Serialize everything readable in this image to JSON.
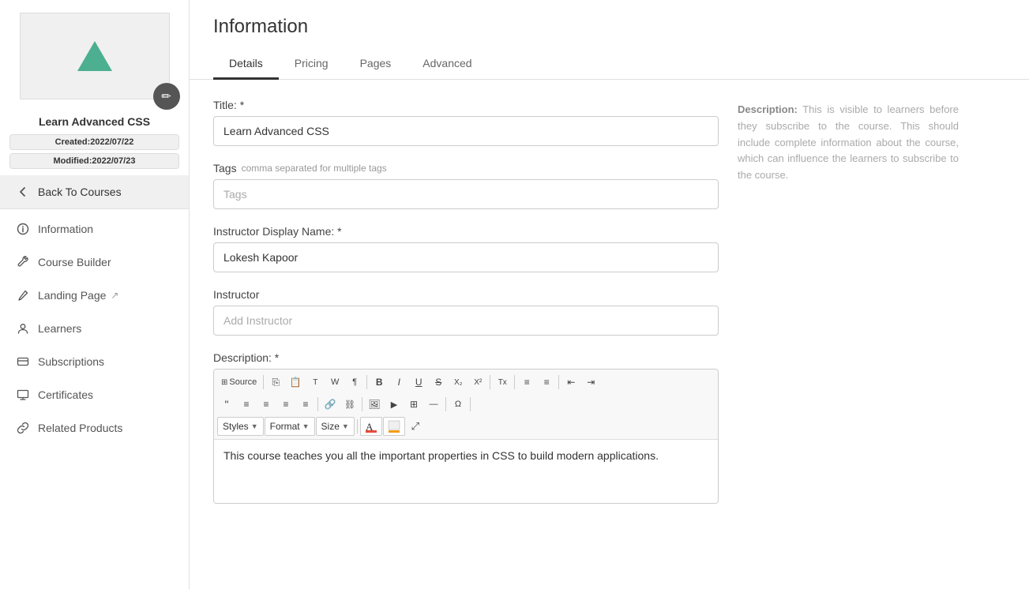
{
  "sidebar": {
    "course_title": "Learn Advanced CSS",
    "created_label": "Created:",
    "created_date": "2022/07/22",
    "modified_label": "Modified:",
    "modified_date": "2022/07/23",
    "back_label": "Back To Courses",
    "nav_items": [
      {
        "id": "information",
        "label": "Information",
        "icon": "info-icon"
      },
      {
        "id": "course-builder",
        "label": "Course Builder",
        "icon": "wrench-icon"
      },
      {
        "id": "landing-page",
        "label": "Landing Page",
        "icon": "pencil-icon",
        "external": true
      },
      {
        "id": "learners",
        "label": "Learners",
        "icon": "person-icon"
      },
      {
        "id": "subscriptions",
        "label": "Subscriptions",
        "icon": "card-icon"
      },
      {
        "id": "certificates",
        "label": "Certificates",
        "icon": "monitor-icon"
      },
      {
        "id": "related-products",
        "label": "Related Products",
        "icon": "link-icon"
      }
    ]
  },
  "page": {
    "title": "Information"
  },
  "tabs": [
    {
      "id": "details",
      "label": "Details",
      "active": true
    },
    {
      "id": "pricing",
      "label": "Pricing",
      "active": false
    },
    {
      "id": "pages",
      "label": "Pages",
      "active": false
    },
    {
      "id": "advanced",
      "label": "Advanced",
      "active": false
    }
  ],
  "form": {
    "title_label": "Title: *",
    "title_value": "Learn Advanced CSS",
    "tags_label": "Tags",
    "tags_hint": "comma separated for multiple tags",
    "tags_placeholder": "Tags",
    "instructor_name_label": "Instructor Display Name: *",
    "instructor_name_value": "Lokesh Kapoor",
    "instructor_label": "Instructor",
    "instructor_placeholder": "Add Instructor",
    "description_label": "Description: *",
    "description_text": "This course teaches you all the important properties in CSS to build modern applications."
  },
  "toolbar": {
    "source_label": "Source",
    "styles_label": "Styles",
    "format_label": "Format",
    "size_label": "Size"
  },
  "hint": {
    "title": "Description:",
    "text": " This is visible to learners before they subscribe to the course. This should include complete information about the course, which can influence the learners to subscribe to the course."
  }
}
